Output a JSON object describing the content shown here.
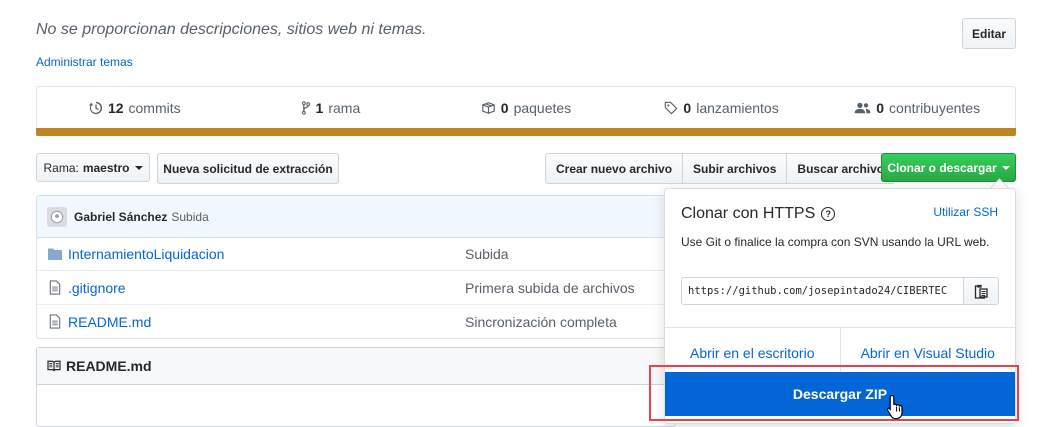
{
  "repo": {
    "description": "No se proporcionan descripciones, sitios web ni temas.",
    "edit_label": "Editar",
    "manage_topics": "Administrar temas"
  },
  "stats": [
    {
      "icon": "history-icon",
      "value": "12",
      "label": "commits"
    },
    {
      "icon": "git-branch-icon",
      "value": "1",
      "label": "rama"
    },
    {
      "icon": "package-icon",
      "value": "0",
      "label": "paquetes"
    },
    {
      "icon": "tag-icon",
      "value": "0",
      "label": "lanzamientos"
    },
    {
      "icon": "people-icon",
      "value": "0",
      "label": "contribuyentes"
    }
  ],
  "colors": {
    "language_bar": "#c08424",
    "accent": "#0366d6",
    "green": "#28a745",
    "highlight": "#e5434e"
  },
  "toolbar": {
    "branch_prefix": "Rama:",
    "branch_name": "maestro",
    "new_pr": "Nueva solicitud de extracción",
    "create_file": "Crear nuevo archivo",
    "upload_files": "Subir archivos",
    "find_file": "Buscar archivo",
    "clone": "Clonar o descargar"
  },
  "commit": {
    "author": "Gabriel Sánchez",
    "message": "Subida"
  },
  "files": [
    {
      "type": "folder",
      "name": "InternamientoLiquidacion",
      "message": "Subida"
    },
    {
      "type": "file",
      "name": ".gitignore",
      "message": "Primera subida de archivos"
    },
    {
      "type": "file",
      "name": "README.md",
      "message": "Sincronización completa"
    }
  ],
  "readme": {
    "title": "README.md"
  },
  "clone_dropdown": {
    "title": "Clonar con HTTPS",
    "use_ssh": "Utilizar SSH",
    "help_text": "Use Git o finalice la compra con SVN usando la URL web.",
    "url": "https://github.com/josepintado24/CIBERTEC",
    "open_desktop": "Abrir en el escritorio",
    "open_vs": "Abrir en Visual Studio",
    "download_zip": "Descargar ZIP"
  }
}
